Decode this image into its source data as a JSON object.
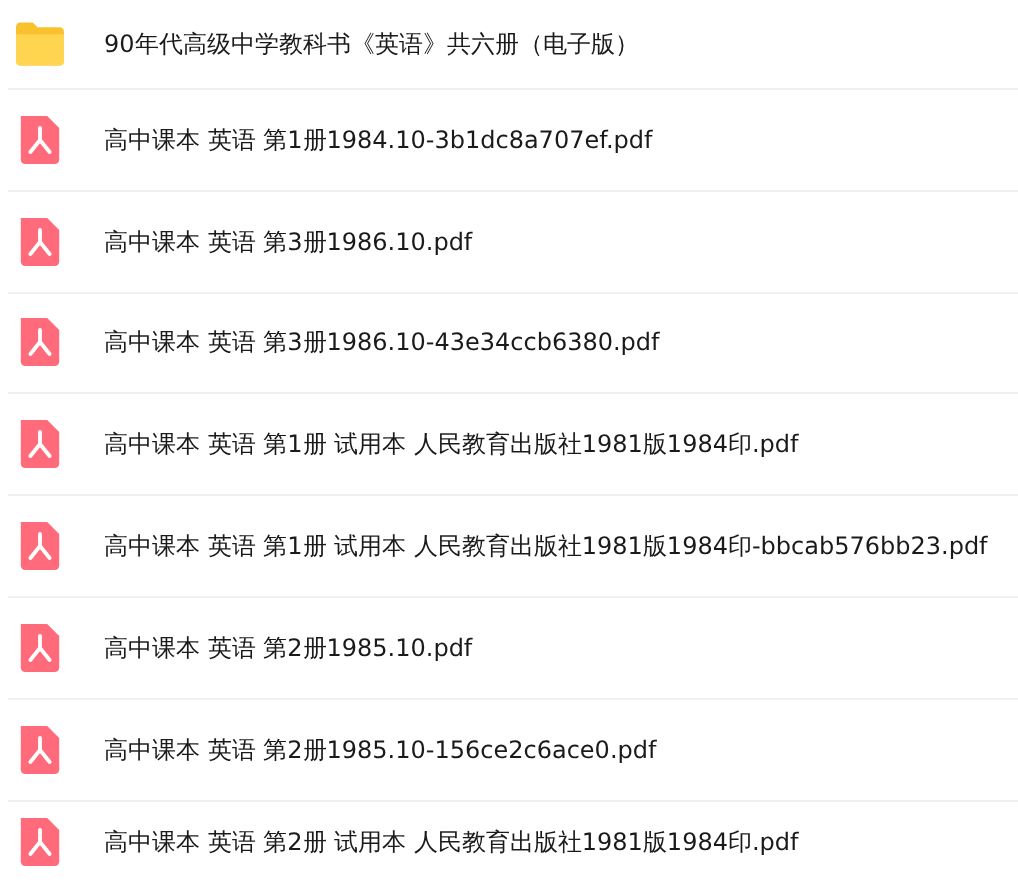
{
  "files": [
    {
      "kind": "folder",
      "name": "90年代高级中学教科书《英语》共六册（电子版）"
    },
    {
      "kind": "pdf",
      "name": "高中课本 英语 第1册1984.10-3b1dc8a707ef.pdf"
    },
    {
      "kind": "pdf",
      "name": "高中课本 英语 第3册1986.10.pdf"
    },
    {
      "kind": "pdf",
      "name": "高中课本 英语 第3册1986.10-43e34ccb6380.pdf"
    },
    {
      "kind": "pdf",
      "name": "高中课本 英语 第1册 试用本 人民教育出版社1981版1984印.pdf"
    },
    {
      "kind": "pdf",
      "name": "高中课本 英语 第1册 试用本 人民教育出版社1981版1984印-bbcab576bb23.pdf"
    },
    {
      "kind": "pdf",
      "name": "高中课本 英语 第2册1985.10.pdf"
    },
    {
      "kind": "pdf",
      "name": "高中课本 英语 第2册1985.10-156ce2c6ace0.pdf"
    },
    {
      "kind": "pdf",
      "name": "高中课本 英语 第2册 试用本 人民教育出版社1981版1984印.pdf"
    }
  ]
}
